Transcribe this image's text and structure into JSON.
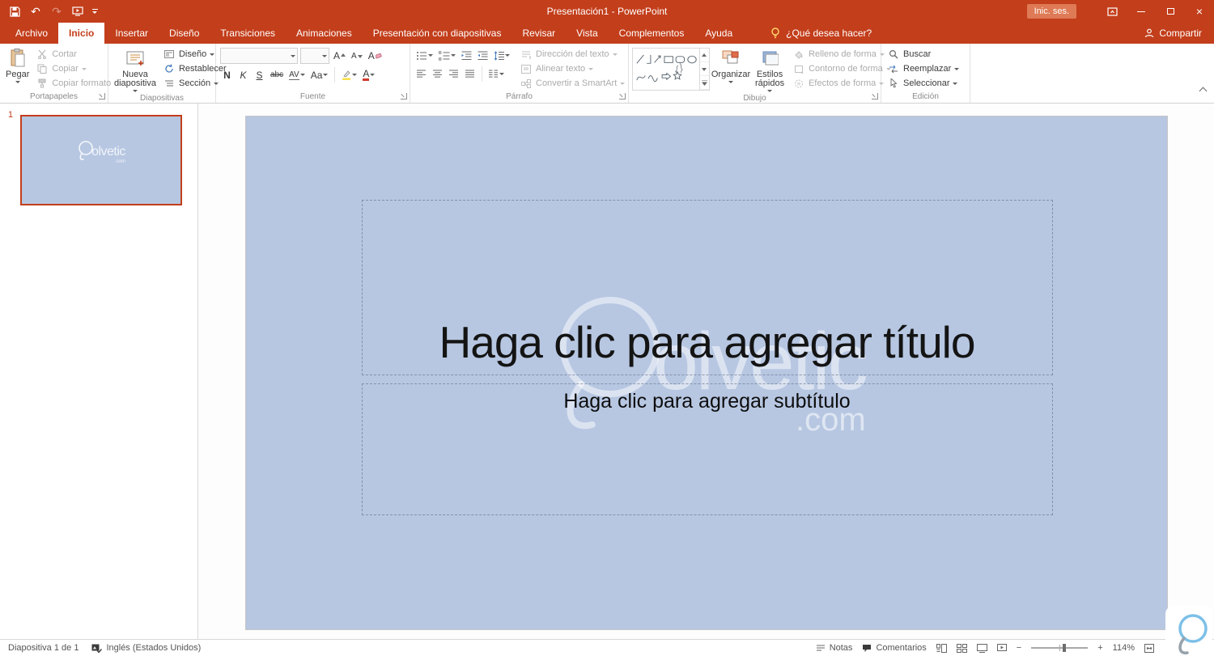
{
  "titlebar": {
    "title": "Presentación1 - PowerPoint",
    "signin": "Inic. ses."
  },
  "tabs": {
    "items": [
      "Archivo",
      "Inicio",
      "Insertar",
      "Diseño",
      "Transiciones",
      "Animaciones",
      "Presentación con diapositivas",
      "Revisar",
      "Vista",
      "Complementos",
      "Ayuda"
    ],
    "tell_me": "¿Qué desea hacer?",
    "share": "Compartir"
  },
  "icons": {
    "undo": "↶",
    "redo": "↷",
    "close": "×",
    "minus": "−",
    "plus": "+"
  },
  "ribbon": {
    "clipboard": {
      "label": "Portapapeles",
      "paste": "Pegar",
      "cut": "Cortar",
      "copy": "Copiar",
      "format_painter": "Copiar formato"
    },
    "slides": {
      "label": "Diapositivas",
      "new_slide": "Nueva diapositiva",
      "layout": "Diseño",
      "reset": "Restablecer",
      "section": "Sección"
    },
    "font": {
      "label": "Fuente",
      "bold": "N",
      "italic": "K",
      "underline": "S",
      "strike": "abc",
      "spacing": "AV",
      "case": "Aa",
      "grow": "A",
      "shrink": "A",
      "clear": "A",
      "color": "A"
    },
    "paragraph": {
      "label": "Párrafo",
      "text_direction": "Dirección del texto",
      "align_text": "Alinear texto",
      "smartart": "Convertir a SmartArt"
    },
    "drawing": {
      "label": "Dibujo",
      "arrange": "Organizar",
      "quick_styles": "Estilos rápidos",
      "fill": "Relleno de forma",
      "outline": "Contorno de forma",
      "effects": "Efectos de forma"
    },
    "editing": {
      "label": "Edición",
      "find": "Buscar",
      "replace": "Reemplazar",
      "select": "Seleccionar"
    }
  },
  "slide_panel": {
    "number": "1"
  },
  "slide": {
    "title": "Haga clic para agregar título",
    "subtitle": "Haga clic para agregar subtítulo",
    "watermark": "olvetic",
    "watermark_sub": ".com"
  },
  "statusbar": {
    "slide_info": "Diapositiva 1 de 1",
    "language": "Inglés (Estados Unidos)",
    "notes": "Notas",
    "comments": "Comentarios",
    "zoom": "114%"
  }
}
